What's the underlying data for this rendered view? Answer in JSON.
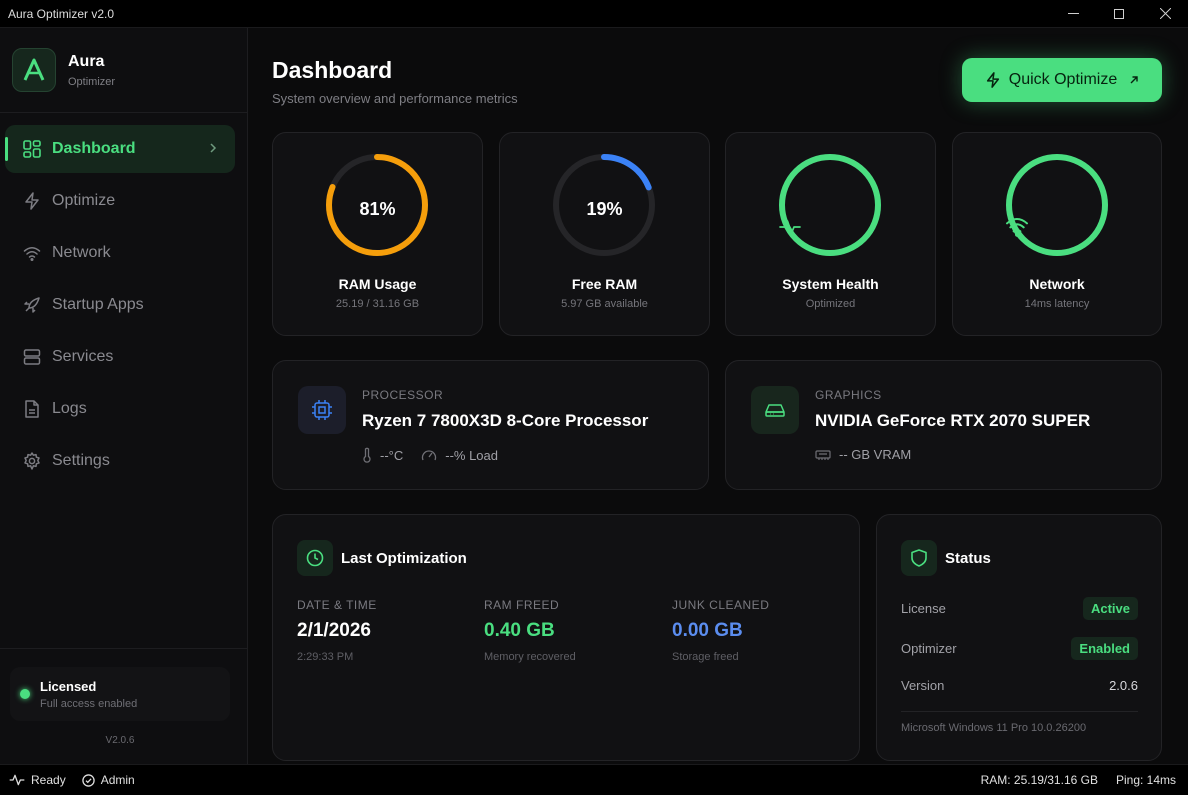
{
  "window": {
    "title": "Aura Optimizer v2.0"
  },
  "brand": {
    "name": "Aura",
    "subtitle": "Optimizer"
  },
  "sidebar": {
    "items": [
      {
        "label": "Dashboard",
        "icon": "grid-icon",
        "active": true
      },
      {
        "label": "Optimize",
        "icon": "lightning-icon"
      },
      {
        "label": "Network",
        "icon": "wifi-icon"
      },
      {
        "label": "Startup Apps",
        "icon": "rocket-icon"
      },
      {
        "label": "Services",
        "icon": "server-icon"
      },
      {
        "label": "Logs",
        "icon": "document-icon"
      },
      {
        "label": "Settings",
        "icon": "gear-icon"
      }
    ],
    "license": {
      "title": "Licensed",
      "subtitle": "Full access enabled"
    },
    "version": "V2.0.6"
  },
  "header": {
    "title": "Dashboard",
    "subtitle": "System overview and performance metrics",
    "quick_optimize": "Quick Optimize"
  },
  "gauges": [
    {
      "value_text": "81%",
      "label": "RAM Usage",
      "sub": "25.19 / 31.16 GB",
      "fraction": 0.81,
      "color": "#f59e0b",
      "icon": ""
    },
    {
      "value_text": "19%",
      "label": "Free RAM",
      "sub": "5.97 GB available",
      "fraction": 0.19,
      "color": "#3b82f6",
      "icon": ""
    },
    {
      "value_text": "",
      "label": "System Health",
      "sub": "Optimized",
      "fraction": 1.0,
      "color": "#4ade80",
      "icon": "pulse-icon"
    },
    {
      "value_text": "",
      "label": "Network",
      "sub": "14ms latency",
      "fraction": 1.0,
      "color": "#4ade80",
      "icon": "wifi-icon"
    }
  ],
  "processor": {
    "caption": "PROCESSOR",
    "name": "Ryzen 7 7800X3D 8-Core Processor",
    "temp": "--°C",
    "load": "--% Load"
  },
  "graphics": {
    "caption": "GRAPHICS",
    "name": "NVIDIA GeForce RTX 2070 SUPER",
    "vram": "-- GB VRAM"
  },
  "last_optimization": {
    "title": "Last Optimization",
    "date_caption": "DATE & TIME",
    "date": "2/1/2026",
    "time": "2:29:33 PM",
    "ram_caption": "RAM FREED",
    "ram_value": "0.40 GB",
    "ram_sub": "Memory recovered",
    "junk_caption": "JUNK CLEANED",
    "junk_value": "0.00 GB",
    "junk_sub": "Storage freed"
  },
  "status": {
    "title": "Status",
    "license_label": "License",
    "license_value": "Active",
    "optimizer_label": "Optimizer",
    "optimizer_value": "Enabled",
    "version_label": "Version",
    "version_value": "2.0.6",
    "os": "Microsoft Windows 11 Pro 10.0.26200"
  },
  "statusbar": {
    "ready": "Ready",
    "admin": "Admin",
    "ram": "RAM: 25.19/31.16 GB",
    "ping": "Ping: 14ms"
  },
  "colors": {
    "accent": "#4ade80",
    "warning": "#f59e0b",
    "info": "#3b82f6"
  }
}
